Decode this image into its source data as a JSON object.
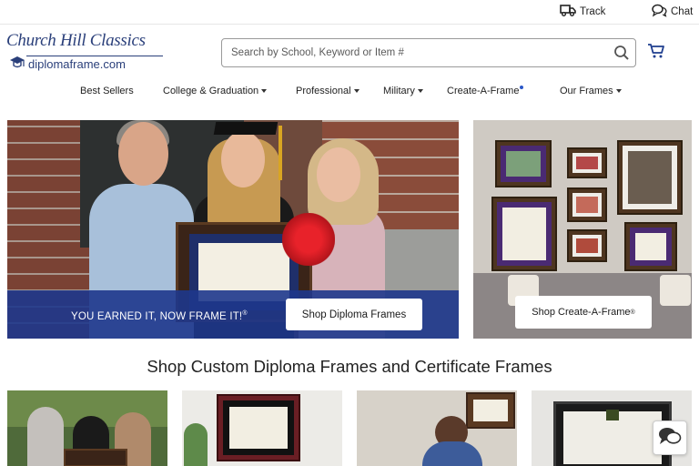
{
  "utility": {
    "track_label": "Track",
    "chat_label": "Chat"
  },
  "brand": {
    "name_top": "Church Hill Classics",
    "name_bottom": "diplomaframe.com",
    "color": "#2a3f7a"
  },
  "search": {
    "placeholder": "Search by School, Keyword or Item #"
  },
  "nav": {
    "items": [
      {
        "label": "Best Sellers"
      },
      {
        "label": "College & Graduation"
      },
      {
        "label": "Professional"
      },
      {
        "label": "Military"
      },
      {
        "label": "Create-A-Frame"
      },
      {
        "label": "Our Frames"
      }
    ]
  },
  "hero": {
    "left": {
      "banner_text": "YOU EARNED IT, NOW FRAME IT!",
      "banner_mark": "®",
      "button_label": "Shop Diploma Frames",
      "banner_color": "#1e378c"
    },
    "right": {
      "button_label": "Shop Create-A-Frame",
      "button_mark": "®"
    }
  },
  "section": {
    "title": "Shop Custom Diploma Frames and Certificate Frames"
  },
  "icons": [
    "truck-icon",
    "chat-bubbles-icon",
    "search-icon",
    "cart-icon",
    "chat-fab-icon"
  ]
}
